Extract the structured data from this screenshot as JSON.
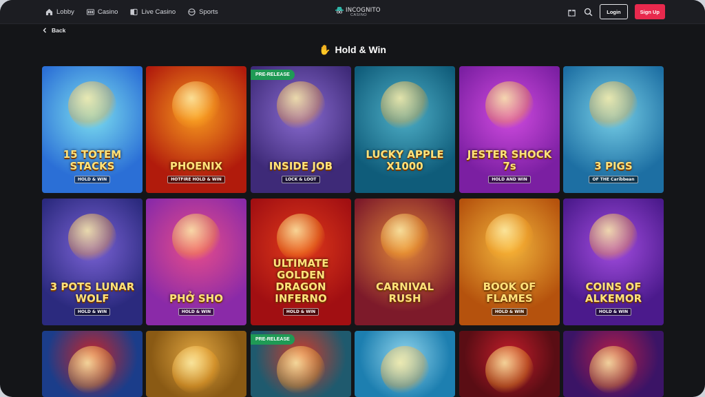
{
  "nav": {
    "items": [
      {
        "label": "Lobby",
        "icon": "home-icon"
      },
      {
        "label": "Casino",
        "icon": "slot-machine-icon"
      },
      {
        "label": "Live Casino",
        "icon": "cards-icon"
      },
      {
        "label": "Sports",
        "icon": "sports-ball-icon"
      }
    ]
  },
  "logo": {
    "text": "INCOGNITO",
    "sub": "CASINO"
  },
  "header": {
    "login_label": "Login",
    "signup_label": "Sign Up",
    "gift_icon": "gift-icon",
    "search_icon": "search-icon"
  },
  "back_label": "Back",
  "page_title": "Hold & Win",
  "page_title_icon": "raised-hand-icon",
  "badge_label": "PRE-RELEASE",
  "games": [
    {
      "title": "15 TOTEM STACKS",
      "sub": "HOLD & WIN",
      "bg": "#2b6fd6",
      "bg2": "#7de0f0",
      "prerelease": false
    },
    {
      "title": "PHOENIX",
      "sub": "HOTFIRE HOLD & WIN",
      "bg": "#b11b0c",
      "bg2": "#f79a1e",
      "prerelease": false
    },
    {
      "title": "INSIDE JOB",
      "sub": "LOCK & LOOT",
      "bg": "#3e2a78",
      "bg2": "#8a6cd1",
      "prerelease": true
    },
    {
      "title": "LUCKY APPLE X1000",
      "sub": "",
      "bg": "#0f5c7a",
      "bg2": "#4fb0c8",
      "prerelease": false
    },
    {
      "title": "JESTER SHOCK 7s",
      "sub": "HOLD AND WIN",
      "bg": "#7b1fa2",
      "bg2": "#d14ce0",
      "prerelease": false
    },
    {
      "title": "3 PIGS",
      "sub": "OF THE Caribbean",
      "bg": "#1d6fa3",
      "bg2": "#78d0e8",
      "prerelease": false
    },
    {
      "title": "3 POTS LUNAR WOLF",
      "sub": "HOLD & WIN",
      "bg": "#2b2a7e",
      "bg2": "#7b63d6",
      "prerelease": false
    },
    {
      "title": "PHỞ SHO",
      "sub": "HOLD & WIN",
      "bg": "#8a2aa8",
      "bg2": "#e84d8a",
      "prerelease": false
    },
    {
      "title": "ULTIMATE GOLDEN DRAGON INFERNO",
      "sub": "HOLD & WIN",
      "bg": "#a10f12",
      "bg2": "#e03a1b",
      "prerelease": false
    },
    {
      "title": "CARNIVAL RUSH",
      "sub": "",
      "bg": "#7d1a2a",
      "bg2": "#e0873a",
      "prerelease": false
    },
    {
      "title": "BOOK OF FLAMES",
      "sub": "HOLD & WIN",
      "bg": "#b5520d",
      "bg2": "#f2b53c",
      "prerelease": false
    },
    {
      "title": "COINS OF ALKEMOR",
      "sub": "HOLD & WIN",
      "bg": "#4b1a8c",
      "bg2": "#a34de0",
      "prerelease": false
    },
    {
      "title": "",
      "sub": "",
      "bg": "#1b3d8a",
      "bg2": "#c7262b",
      "prerelease": false
    },
    {
      "title": "",
      "sub": "",
      "bg": "#8a5a14",
      "bg2": "#e0a540",
      "prerelease": false
    },
    {
      "title": "",
      "sub": "",
      "bg": "#1f5a6e",
      "bg2": "#d03a2a",
      "prerelease": true
    },
    {
      "title": "",
      "sub": "",
      "bg": "#1d7fb0",
      "bg2": "#8fd4ec",
      "prerelease": false
    },
    {
      "title": "",
      "sub": "",
      "bg": "#5a0d14",
      "bg2": "#c11d2a",
      "prerelease": false
    },
    {
      "title": "",
      "sub": "",
      "bg": "#3b1466",
      "bg2": "#b21d4a",
      "prerelease": false
    }
  ]
}
